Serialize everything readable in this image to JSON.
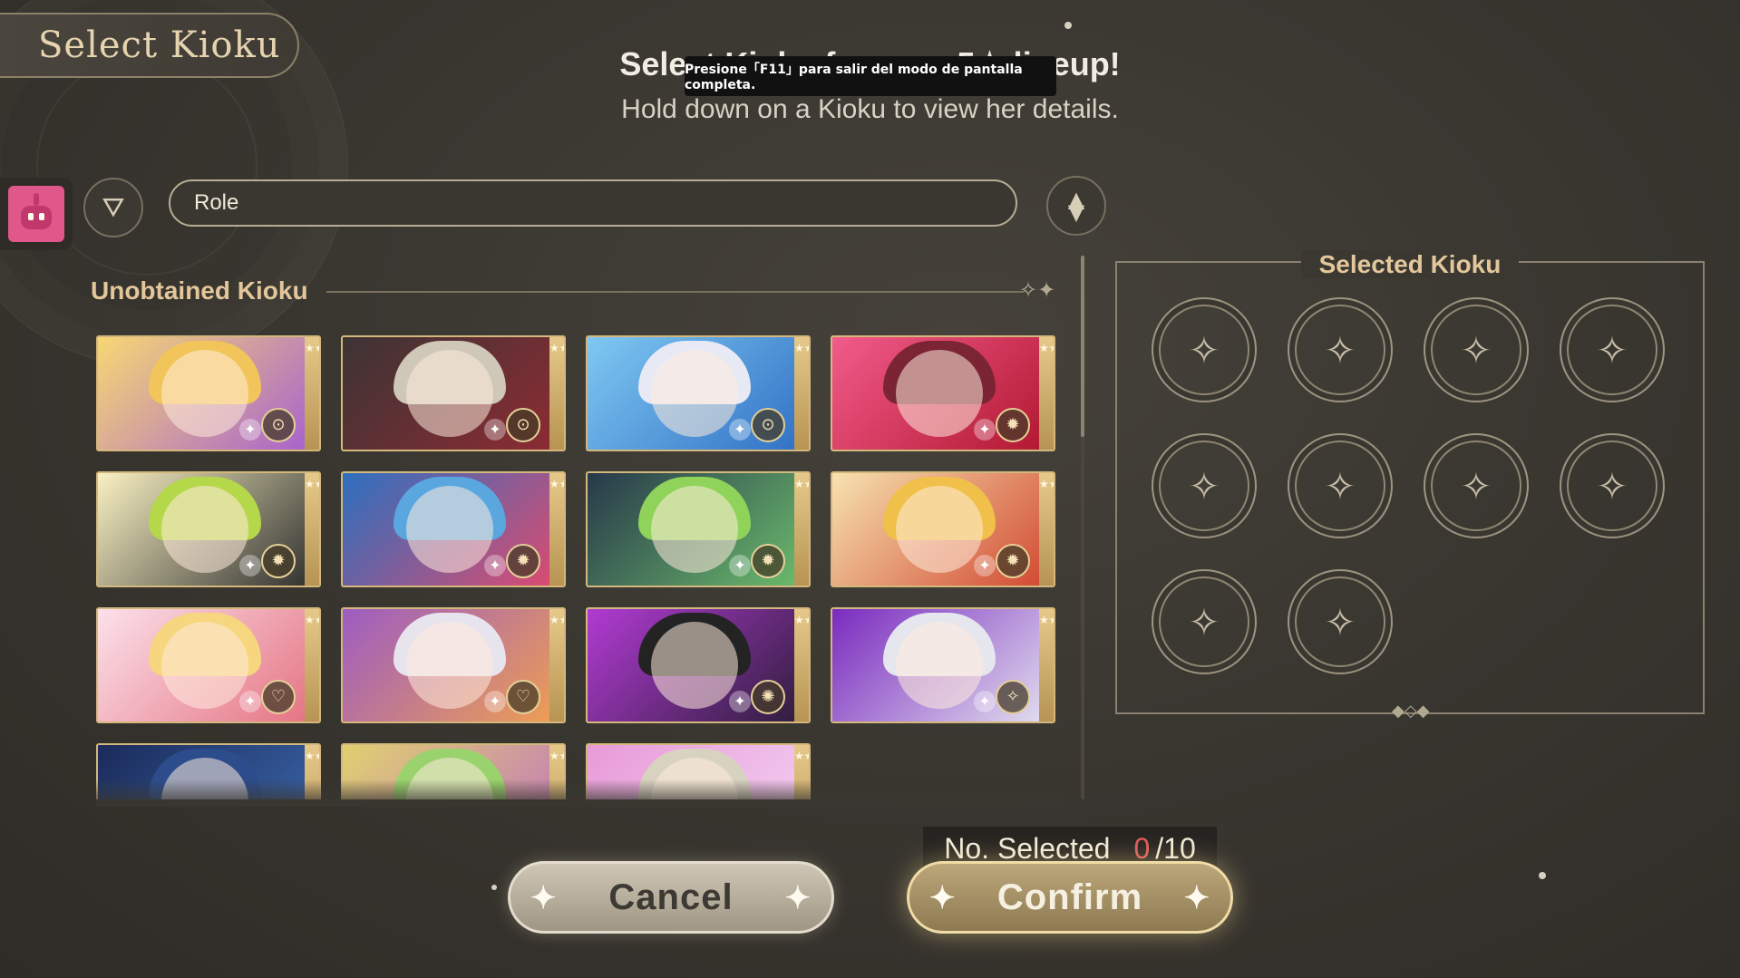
{
  "header": {
    "tab_title": "Select Kioku",
    "heading": "Select Kioku for your 5★ lineup!",
    "subheading": "Hold down on a Kioku to view her details."
  },
  "toast": "Presione「F11」para salir del modo de pantalla completa.",
  "toolbar": {
    "filter_field_value": "Role"
  },
  "unobtained": {
    "label": "Unobtained Kioku",
    "cards": [
      {
        "theme": "gold-purple",
        "hair": "#f2c55a",
        "bg": "linear-gradient(135deg,#f7d774,#a55fd0)",
        "role_icon": "⊙"
      },
      {
        "theme": "dark-red",
        "hair": "#cfc7b7",
        "bg": "linear-gradient(135deg,#3c3434,#8f2b33)",
        "role_icon": "⊙"
      },
      {
        "theme": "sky-blue",
        "hair": "#e7eaf5",
        "bg": "linear-gradient(135deg,#7fc8f2,#2f6fc4)",
        "role_icon": "⊙"
      },
      {
        "theme": "pink-red",
        "hair": "#7a2434",
        "bg": "linear-gradient(135deg,#f25b8b,#b0162e)",
        "role_icon": "✹"
      },
      {
        "theme": "yellow-black",
        "hair": "#b5d84a",
        "bg": "linear-gradient(135deg,#f9f1c2,#2c2c2c)",
        "role_icon": "✹"
      },
      {
        "theme": "blue",
        "hair": "#5aa7e0",
        "bg": "linear-gradient(135deg,#2c6fbf,#e24a6e)",
        "role_icon": "✹"
      },
      {
        "theme": "green-night",
        "hair": "#8fd35a",
        "bg": "linear-gradient(135deg,#27384a,#6dbf6d)",
        "role_icon": "✹"
      },
      {
        "theme": "gold-orange",
        "hair": "#f0c04a",
        "bg": "linear-gradient(135deg,#f7e2b0,#d0452e)",
        "role_icon": "✹"
      },
      {
        "theme": "pink-light",
        "hair": "#f6d67e",
        "bg": "linear-gradient(135deg,#fbe1ea,#e4707f)",
        "role_icon": "♡"
      },
      {
        "theme": "purple-orange",
        "hair": "#e8e4ee",
        "bg": "linear-gradient(135deg,#9c5cc2,#f0a050)",
        "role_icon": "♡"
      },
      {
        "theme": "purple-dark",
        "hair": "#232323",
        "bg": "linear-gradient(135deg,#b13bd3,#2c1d38)",
        "role_icon": "✺"
      },
      {
        "theme": "violet-white",
        "hair": "#e6e6ee",
        "bg": "linear-gradient(135deg,#7a2bbf,#e4e2f0)",
        "role_icon": "✧"
      },
      {
        "theme": "navy",
        "hair": "#2c4c8c",
        "bg": "linear-gradient(135deg,#1b2b5a,#3d6ab0)",
        "role_icon": ""
      },
      {
        "theme": "multicolor",
        "hair": "#9ad36e",
        "bg": "linear-gradient(135deg,#e0d070,#c070c0)",
        "role_icon": ""
      },
      {
        "theme": "lilac",
        "hair": "#d8d2c0",
        "bg": "linear-gradient(135deg,#e89ad8,#f4d4f4)",
        "role_icon": ""
      }
    ]
  },
  "selected": {
    "label": "Selected Kioku",
    "slot_count": 10
  },
  "footer": {
    "count_label": "No. Selected",
    "count_current": "0",
    "count_total": "/10",
    "cancel_label": "Cancel",
    "confirm_label": "Confirm"
  },
  "colors": {
    "accent_gold": "#e3c79b",
    "count_red": "#e05a5a"
  }
}
